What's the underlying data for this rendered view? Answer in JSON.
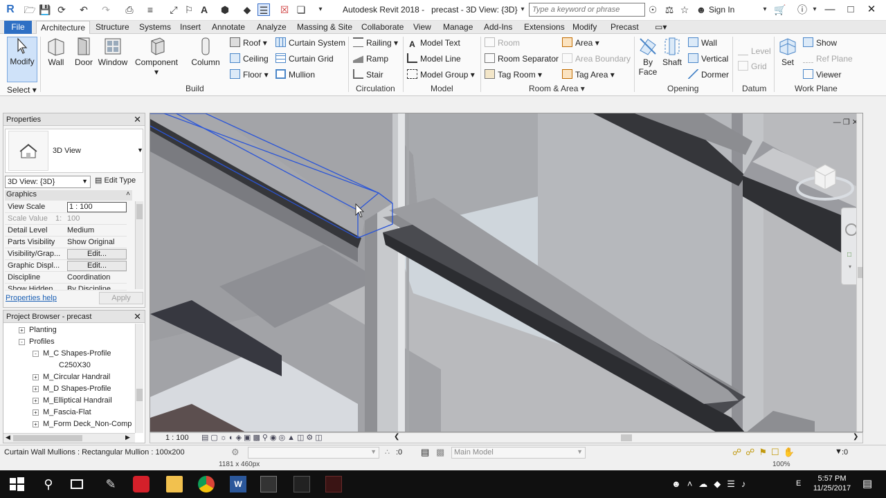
{
  "titlebar": {
    "app_title": "Autodesk Revit 2018 -",
    "document": "precast - 3D View: {3D}",
    "search_placeholder": "Type a keyword or phrase",
    "sign_in": "Sign In"
  },
  "ribbon_tabs": [
    "File",
    "Architecture",
    "Structure",
    "Systems",
    "Insert",
    "Annotate",
    "Analyze",
    "Massing & Site",
    "Collaborate",
    "View",
    "Manage",
    "Add-Ins",
    "Extensions",
    "Modify",
    "Precast"
  ],
  "ribbon": {
    "modify": "Modify",
    "select": "Select",
    "build": {
      "wall": "Wall",
      "door": "Door",
      "window": "Window",
      "component": "Component",
      "column": "Column",
      "roof": "Roof",
      "ceiling": "Ceiling",
      "floor": "Floor",
      "curtain_system": "Curtain System",
      "curtain_grid": "Curtain Grid",
      "mullion": "Mullion",
      "label": "Build"
    },
    "circulation": {
      "railing": "Railing",
      "ramp": "Ramp",
      "stair": "Stair",
      "label": "Circulation"
    },
    "model": {
      "model_text": "Model Text",
      "model_line": "Model Line",
      "model_group": "Model Group",
      "label": "Model"
    },
    "room_area": {
      "room": "Room",
      "room_separator": "Room Separator",
      "tag_room": "Tag Room",
      "area": "Area",
      "area_boundary": "Area Boundary",
      "tag_area": "Tag Area",
      "label": "Room & Area"
    },
    "opening": {
      "by_face_1": "By",
      "by_face_2": "Face",
      "shaft": "Shaft",
      "wall": "Wall",
      "vertical": "Vertical",
      "dormer": "Dormer",
      "label": "Opening"
    },
    "datum": {
      "level": "Level",
      "grid": "Grid",
      "label": "Datum"
    },
    "work_plane": {
      "set": "Set",
      "show": "Show",
      "ref_plane": "Ref Plane",
      "viewer": "Viewer",
      "label": "Work Plane"
    }
  },
  "properties": {
    "title": "Properties",
    "type_name": "3D View",
    "instance": "3D View: {3D}",
    "edit_type": "Edit Type",
    "section": "Graphics",
    "rows": [
      {
        "k": "View Scale",
        "v": "1 : 100"
      },
      {
        "k": "Scale Value",
        "v": "100",
        "prefix": "1:"
      },
      {
        "k": "Detail Level",
        "v": "Medium"
      },
      {
        "k": "Parts Visibility",
        "v": "Show Original"
      },
      {
        "k": "Visibility/Grap...",
        "v": "Edit..."
      },
      {
        "k": "Graphic Displ...",
        "v": "Edit..."
      },
      {
        "k": "Discipline",
        "v": "Coordination"
      },
      {
        "k": "Show Hidden ...",
        "v": "By Discipline"
      }
    ],
    "help": "Properties help",
    "apply": "Apply"
  },
  "browser": {
    "title": "Project Browser - precast",
    "items": [
      {
        "label": "Planting",
        "box": "+"
      },
      {
        "label": "Profiles",
        "box": "-"
      },
      {
        "label": "M_C Shapes-Profile",
        "box": "-"
      },
      {
        "label": "C250X30",
        "box": ""
      },
      {
        "label": "M_Circular Handrail",
        "box": "+"
      },
      {
        "label": "M_D Shapes-Profile",
        "box": "+"
      },
      {
        "label": "M_Elliptical Handrail",
        "box": "+"
      },
      {
        "label": "M_Fascia-Flat",
        "box": "+"
      },
      {
        "label": "M_Form Deck_Non-Comp",
        "box": "+"
      }
    ]
  },
  "viewbar": {
    "scale": "1 : 100"
  },
  "statusbar": {
    "selection_info": "Curtain Wall Mullions : Rectangular Mullion : 100x200",
    "count": ":0",
    "model_dropdown": "Main Model",
    "dims": "1181 x 460px",
    "zoom": "100%"
  },
  "taskbar": {
    "time": "5:57 PM",
    "date": "11/25/2017",
    "lang": "E"
  },
  "colors": {
    "file_tab": "#2e6fc4",
    "selection": "#2a55d8",
    "taskbar": "#101010"
  }
}
